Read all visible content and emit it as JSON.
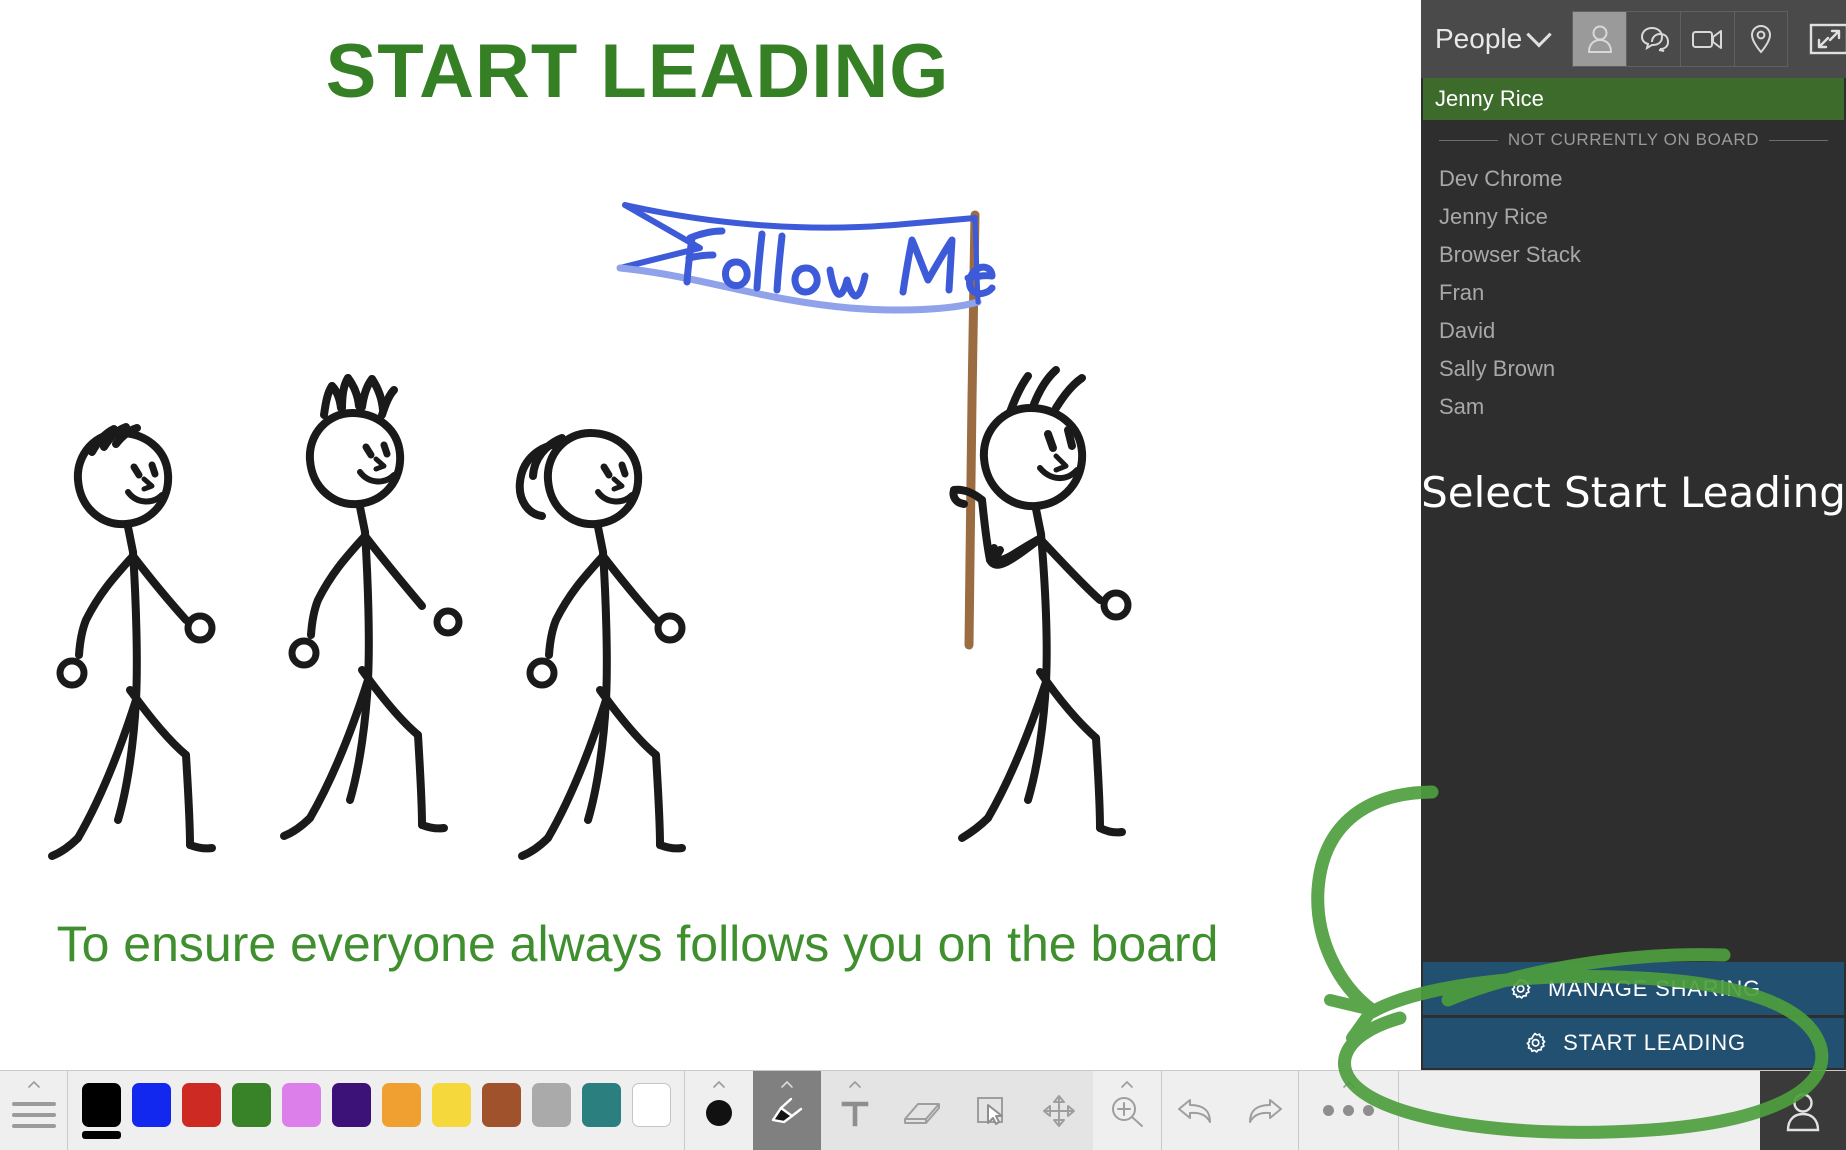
{
  "board": {
    "title": "START LEADING",
    "caption": "To ensure everyone always follows you on the board",
    "flag_text": "Follow Me",
    "title_color": "#358024",
    "caption_color": "#3f8f2f",
    "flag_color": "#3d5ad8",
    "pole_color": "#9b6b42",
    "figure_ink": "#1a1a1a",
    "annotation_color": "#4e9e3e"
  },
  "sidebar": {
    "panel_title": "People",
    "mode_tabs": [
      {
        "name": "people",
        "icon": "person-icon",
        "active": true
      },
      {
        "name": "chat",
        "icon": "chat-bubbles-icon",
        "active": false
      },
      {
        "name": "video",
        "icon": "video-camera-icon",
        "active": false
      },
      {
        "name": "location",
        "icon": "location-pin-icon",
        "active": false
      }
    ],
    "expand_icon": "expand-collapse-icon",
    "active_person": "Jenny Rice",
    "offboard_header": "NOT CURRENTLY ON BOARD",
    "offboard_people": [
      "Dev Chrome",
      "Jenny Rice",
      "Browser Stack",
      "Fran",
      "David",
      "Sally Brown",
      "Sam"
    ],
    "annotation_note": "Select Start Leading",
    "actions": [
      {
        "label": "MANAGE SHARING",
        "icon": "gear-icon"
      },
      {
        "label": "START LEADING",
        "icon": "gear-icon"
      }
    ],
    "colors": {
      "panel_bg": "#2e2e2e",
      "header_bg": "#4a4a4a",
      "active_person_bg": "#3c6b2c",
      "action_bg": "#215070"
    }
  },
  "toolbar": {
    "menu_icon": "hamburger-menu-icon",
    "palette": [
      {
        "name": "black",
        "hex": "#000000",
        "selected": true
      },
      {
        "name": "blue",
        "hex": "#1228ee",
        "selected": false
      },
      {
        "name": "red",
        "hex": "#cc2a22",
        "selected": false
      },
      {
        "name": "green",
        "hex": "#388228",
        "selected": false
      },
      {
        "name": "orchid",
        "hex": "#dd7fea",
        "selected": false
      },
      {
        "name": "purple",
        "hex": "#3c1178",
        "selected": false
      },
      {
        "name": "orange",
        "hex": "#f0a030",
        "selected": false
      },
      {
        "name": "yellow",
        "hex": "#f5d83c",
        "selected": false
      },
      {
        "name": "brown",
        "hex": "#a0522d",
        "selected": false
      },
      {
        "name": "gray",
        "hex": "#aaaaaa",
        "selected": false
      },
      {
        "name": "teal",
        "hex": "#2b7f7f",
        "selected": false
      },
      {
        "name": "white",
        "hex": "#ffffff",
        "selected": false
      }
    ],
    "tools": [
      {
        "name": "stroke-size",
        "icon": "filled-circle-icon",
        "active": false,
        "has_caret": true
      },
      {
        "name": "pen",
        "icon": "pen-icon",
        "active": true,
        "has_caret": true
      },
      {
        "name": "text",
        "icon": "text-icon",
        "active": false,
        "has_caret": true
      },
      {
        "name": "eraser",
        "icon": "eraser-icon",
        "active": false,
        "has_caret": false
      },
      {
        "name": "select",
        "icon": "select-cursor-icon",
        "active": false,
        "has_caret": false
      },
      {
        "name": "pan",
        "icon": "move-arrows-icon",
        "active": false,
        "has_caret": false
      },
      {
        "name": "zoom",
        "icon": "magnifier-plus-icon",
        "active": false,
        "has_caret": true
      }
    ],
    "history": [
      {
        "name": "undo",
        "icon": "undo-arrow-icon"
      },
      {
        "name": "redo",
        "icon": "redo-arrow-icon"
      }
    ],
    "more": {
      "name": "more-options",
      "icon": "three-dots-icon",
      "has_caret": true
    },
    "avatar": {
      "name": "user-avatar",
      "icon": "person-icon"
    }
  }
}
